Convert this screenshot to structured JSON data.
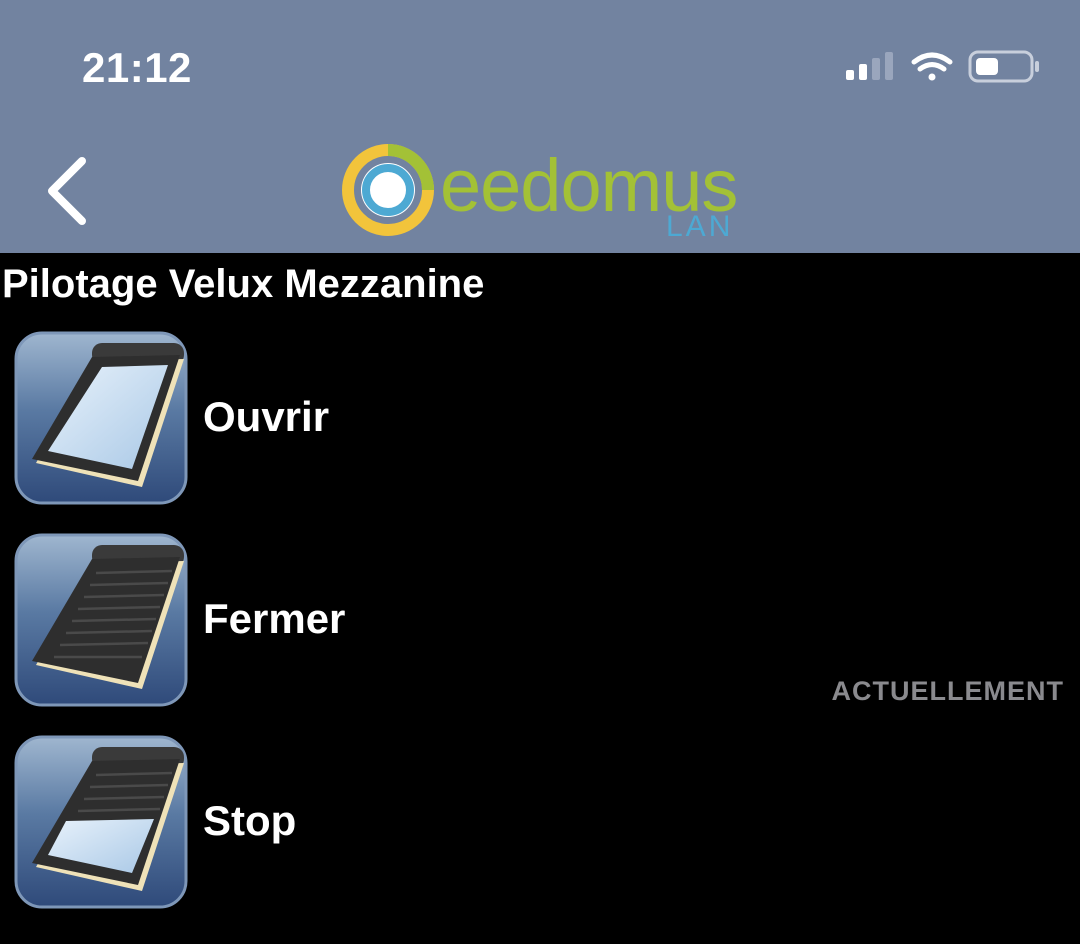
{
  "status_bar": {
    "time": "21:12",
    "icons": [
      "cellular-signal-icon",
      "wifi-icon",
      "battery-icon"
    ]
  },
  "nav": {
    "back_icon": "chevron-left-icon",
    "logo_text": "eedomus",
    "logo_subtext": "LAN"
  },
  "page": {
    "title": "Pilotage Velux Mezzanine"
  },
  "actions": [
    {
      "label": "Ouvrir",
      "icon": "roof-window-open-icon"
    },
    {
      "label": "Fermer",
      "icon": "roof-window-closed-icon"
    },
    {
      "label": "Stop",
      "icon": "roof-window-half-icon"
    }
  ],
  "current_state_caption": "ACTUELLEMENT",
  "colors": {
    "header_bg": "#7283a0",
    "body_bg": "#000000",
    "logo_green": "#a3c136",
    "logo_blue": "#4da9d3",
    "logo_yellow": "#f2c43b",
    "caption_gray": "#8a8a8e"
  }
}
